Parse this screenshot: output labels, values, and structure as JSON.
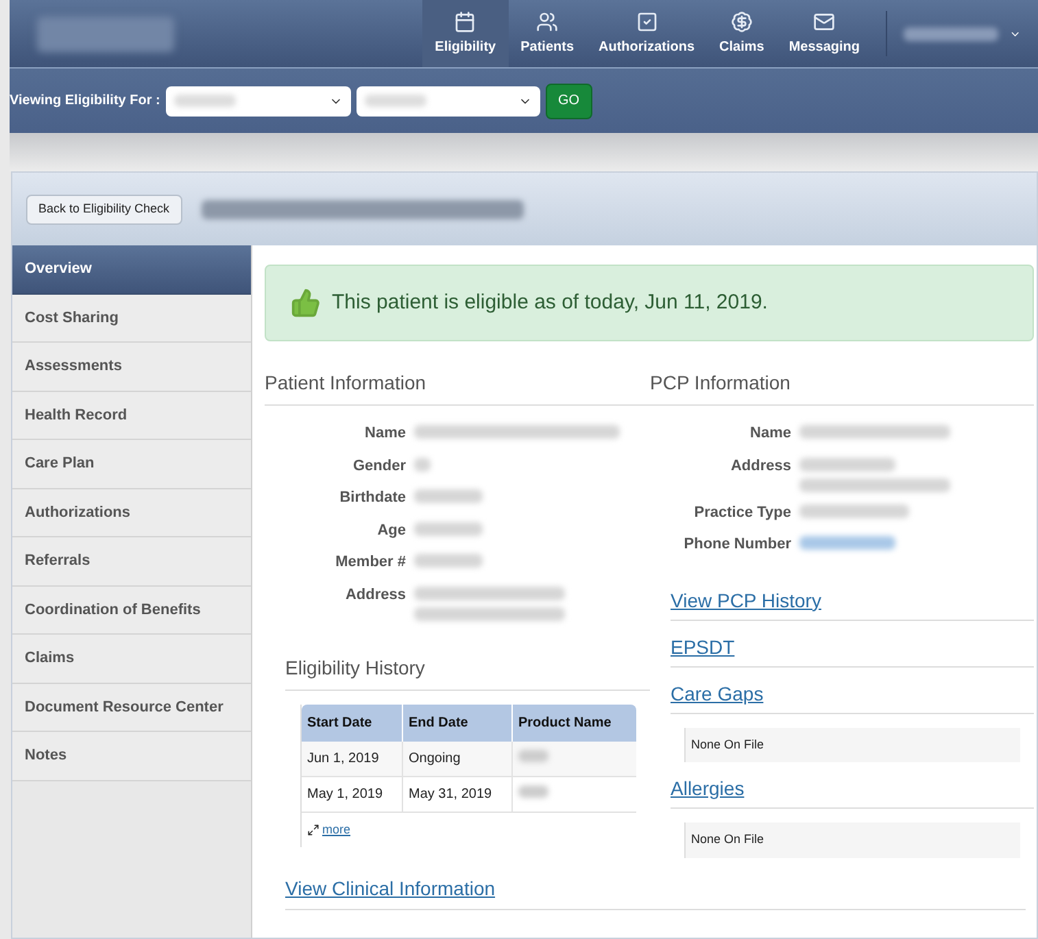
{
  "nav": {
    "items": [
      {
        "label": "Eligibility",
        "selected": true
      },
      {
        "label": "Patients",
        "selected": false
      },
      {
        "label": "Authorizations",
        "selected": false
      },
      {
        "label": "Claims",
        "selected": false
      },
      {
        "label": "Messaging",
        "selected": false
      }
    ]
  },
  "filter": {
    "label": "Viewing Eligibility For :",
    "go": "GO"
  },
  "back_button": "Back to Eligibility Check",
  "sidebar": {
    "items": [
      {
        "label": "Overview",
        "selected": true
      },
      {
        "label": "Cost Sharing",
        "selected": false
      },
      {
        "label": "Assessments",
        "selected": false
      },
      {
        "label": "Health Record",
        "selected": false
      },
      {
        "label": "Care Plan",
        "selected": false
      },
      {
        "label": "Authorizations",
        "selected": false
      },
      {
        "label": "Referrals",
        "selected": false
      },
      {
        "label": "Coordination of Benefits",
        "selected": false
      },
      {
        "label": "Claims",
        "selected": false
      },
      {
        "label": "Document Resource Center",
        "selected": false
      },
      {
        "label": "Notes",
        "selected": false
      }
    ]
  },
  "alert": "This patient is eligible as of today, Jun 11, 2019.",
  "patient_info": {
    "title": "Patient Information",
    "fields": [
      "Name",
      "Gender",
      "Birthdate",
      "Age",
      "Member #",
      "Address"
    ]
  },
  "pcp_info": {
    "title": "PCP Information",
    "fields": [
      "Name",
      "Address",
      "Practice Type",
      "Phone Number"
    ]
  },
  "eligibility_history": {
    "title": "Eligibility History",
    "columns": [
      "Start Date",
      "End Date",
      "Product Name"
    ],
    "rows": [
      [
        "Jun 1, 2019",
        "Ongoing"
      ],
      [
        "May 1, 2019",
        "May 31, 2019"
      ]
    ],
    "more": "more"
  },
  "links": [
    {
      "label": "View PCP History"
    },
    {
      "label": "EPSDT"
    },
    {
      "label": "Care Gaps",
      "note": "None On File"
    },
    {
      "label": "Allergies",
      "note": "None On File"
    }
  ],
  "clinical_link": "View Clinical Information"
}
